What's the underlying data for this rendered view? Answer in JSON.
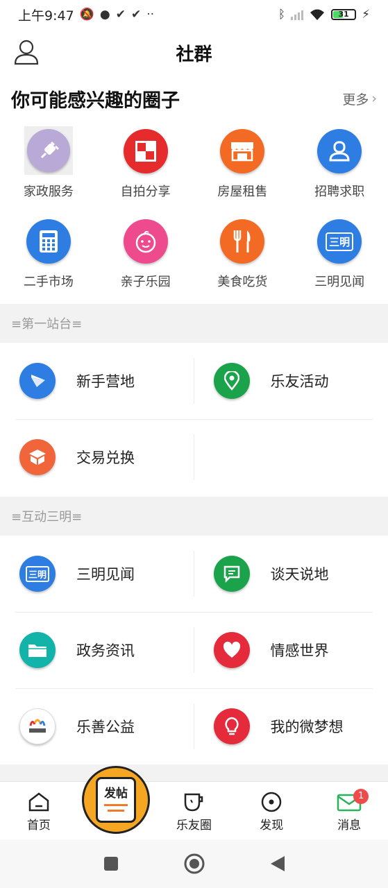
{
  "status_bar": {
    "time": "上午9:47",
    "extra": "··",
    "battery": "31"
  },
  "header": {
    "title": "社群"
  },
  "interest": {
    "heading": "你可能感兴趣的圈子",
    "more": "更多",
    "items": [
      {
        "label": "家政服务",
        "icon": "plug-icon",
        "color": "#b8a9d6"
      },
      {
        "label": "自拍分享",
        "icon": "photo-frame-icon",
        "color": "#e52b2b"
      },
      {
        "label": "房屋租售",
        "icon": "storefront-icon",
        "color": "#f26a23"
      },
      {
        "label": "招聘求职",
        "icon": "person-icon",
        "color": "#2d7de3"
      },
      {
        "label": "二手市场",
        "icon": "calculator-icon",
        "color": "#2d7de3"
      },
      {
        "label": "亲子乐园",
        "icon": "baby-icon",
        "color": "#ee4b8e"
      },
      {
        "label": "美食吃货",
        "icon": "fork-knife-icon",
        "color": "#f26a23"
      },
      {
        "label": "三明见闻",
        "icon": "sanming-icon",
        "color": "#2d7de3",
        "icon_text": "三明"
      }
    ]
  },
  "sections": [
    {
      "band": "≡第一站台≡",
      "items": [
        {
          "label": "新手营地",
          "icon": "paper-plane-icon",
          "color": "#2d7de3"
        },
        {
          "label": "乐友活动",
          "icon": "location-pin-icon",
          "color": "#1aa34a"
        },
        {
          "label": "交易兑换",
          "icon": "box-icon",
          "color": "#f0663a"
        }
      ]
    },
    {
      "band": "≡互动三明≡",
      "items": [
        {
          "label": "三明见闻",
          "icon": "sanming-icon",
          "color": "#2d7de3",
          "icon_text": "三明"
        },
        {
          "label": "谈天说地",
          "icon": "chat-bubble-icon",
          "color": "#1aa34a"
        },
        {
          "label": "政务资讯",
          "icon": "folder-icon",
          "color": "#12b3a8"
        },
        {
          "label": "情感世界",
          "icon": "heart-icon",
          "color": "#e52b3b"
        },
        {
          "label": "乐善公益",
          "icon": "charity-logo-icon",
          "color": "#ffffff"
        },
        {
          "label": "我的微梦想",
          "icon": "lightbulb-icon",
          "color": "#e52b3b"
        }
      ]
    }
  ],
  "bottom_nav": {
    "home": "首页",
    "post": "发帖",
    "circle": "乐友圈",
    "discover": "发现",
    "messages": "消息",
    "badge": "1"
  },
  "colors": {
    "fab": "#f5a623",
    "band_bg": "#f2f2f2",
    "message_green": "#27b35a"
  }
}
